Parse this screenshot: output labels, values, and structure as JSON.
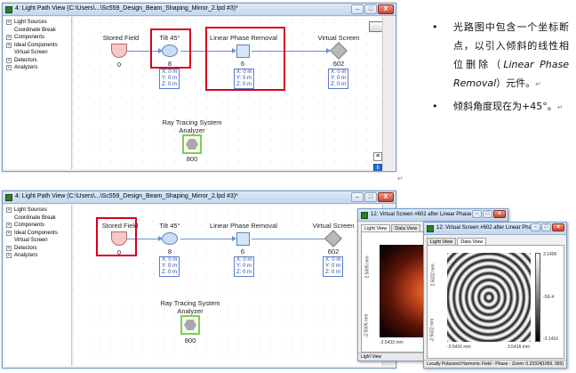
{
  "window_top": {
    "title": "4: Light Path View (C:\\Users\\...\\Sc559_Design_Beam_Shaping_Mirror_2.lpd #3)*",
    "buttons": {
      "minimize": "–",
      "maximize": "□",
      "close": "X"
    },
    "tree": [
      {
        "label": "Light Sources",
        "expandable": true
      },
      {
        "label": "Coordinate Break",
        "expandable": false
      },
      {
        "label": "Components",
        "expandable": true
      },
      {
        "label": "Ideal Components",
        "expandable": true
      },
      {
        "label": "Virtual Screen",
        "expandable": false
      },
      {
        "label": "Detectors",
        "expandable": true
      },
      {
        "label": "Analyzers",
        "expandable": true
      }
    ],
    "nodes": {
      "stored_field": {
        "label": "Stored Field",
        "id": "0"
      },
      "tilt": {
        "label": "Tilt 45°",
        "id": "8",
        "coords": [
          "X: 0 m",
          "Y: 0 m",
          "Z: 0 m"
        ]
      },
      "lpr": {
        "label": "Linear Phase Removal",
        "id": "6",
        "coords": [
          "X: 0 m",
          "Y: 0 m",
          "Z: 0 m"
        ]
      },
      "vscreen": {
        "label": "Virtual Screen",
        "id": "602",
        "coords": [
          "X: 0 m",
          "Y: 0 m",
          "Z: 0 m"
        ]
      },
      "analyzer": {
        "label_line1": "Ray Tracing System",
        "label_line2": "Analyzer",
        "id": "800"
      }
    }
  },
  "window_bottom": {
    "title": "4: Light Path View (C:\\Users\\...\\Sc559_Design_Beam_Shaping_Mirror_2.lpd #3)*",
    "buttons": {
      "minimize": "–",
      "maximize": "□",
      "close": "X"
    },
    "tree": [
      {
        "label": "Light Sources",
        "expandable": true
      },
      {
        "label": "Coordinate Break",
        "expandable": false
      },
      {
        "label": "Components",
        "expandable": true
      },
      {
        "label": "Ideal Components",
        "expandable": true
      },
      {
        "label": "Virtual Screen",
        "expandable": false
      },
      {
        "label": "Detectors",
        "expandable": true
      },
      {
        "label": "Analyzers",
        "expandable": true
      }
    ],
    "nodes": {
      "stored_field": {
        "label": "Stored Field",
        "id": "0"
      },
      "tilt": {
        "label": "Tilt 45°",
        "id": "8",
        "coords": [
          "X: 0 m",
          "Y: 0 m",
          "Z: 0 m"
        ]
      },
      "lpr": {
        "label": "Linear Phase Removal",
        "id": "6",
        "coords": [
          "X: 0 m",
          "Y: 0 m",
          "Z: 0 m"
        ]
      },
      "vscreen": {
        "label": "Virtual Screen",
        "id": "602",
        "coords": [
          "X: 0 m",
          "Y: 0 m",
          "Z: 0 m"
        ]
      },
      "analyzer": {
        "label_line1": "Ray Tracing System",
        "label_line2": "Analyzer",
        "id": "800"
      }
    }
  },
  "notes": {
    "bullet": "•",
    "item1_part1": "光路图中包含一个坐标断点，以引入倾斜的线性相位删除（",
    "item1_italic": "Linear Phase Removal",
    "item1_part2": "）元件。",
    "item2": "倾斜角度现在为+45°。",
    "para_mark": "↵"
  },
  "child1": {
    "title": "12: Virtual Screen #602 after Linear Phase ...",
    "tabs": [
      "Light View",
      "Data View"
    ],
    "active_tab": 0,
    "y_top": "2.5005 mm",
    "y_bottom": "-2.5005 mm",
    "x_left": "-3.5433 mm",
    "x_right": "3.5433 mm",
    "status": "Light View"
  },
  "child2": {
    "title": "12: Virtual Screen #602 after Linear Phase ...",
    "tabs": [
      "Light View",
      "Data View"
    ],
    "active_tab": 1,
    "y_top": "2.5022 mm",
    "y_bottom": "-2.5022 mm",
    "x_left": "-3.5416 mm",
    "x_right": "3.5416 mm",
    "colorbar": [
      "3.1406",
      "-5E-4",
      "-3.1416"
    ],
    "status": "Locally Polarized Harmonic Field - Phase · Zoom: 0.23324",
    "status_right": "(1059, 993)"
  }
}
